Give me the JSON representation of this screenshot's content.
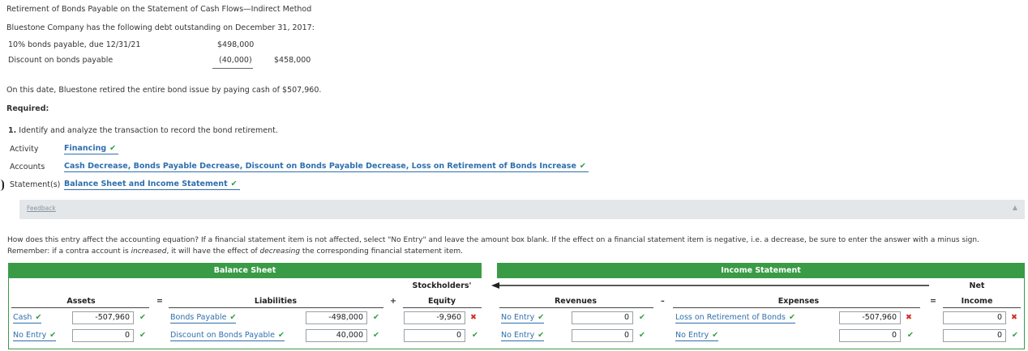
{
  "header": {
    "title": "Retirement of Bonds Payable on the Statement of Cash Flows—Indirect Method",
    "intro": "Bluestone Company has the following debt outstanding on December 31, 2017:",
    "debt": [
      {
        "label": "10% bonds payable, due 12/31/21",
        "amount": "$498,000",
        "net": ""
      },
      {
        "label": "Discount on bonds payable",
        "amount": "(40,000)",
        "net": "$458,000"
      }
    ],
    "retire_text": "On this date, Bluestone retired the entire bond issue by paying cash of $507,960.",
    "required": "Required:",
    "step1_num": "1.",
    "step1_text": "Identify and analyze the transaction to record the bond retirement."
  },
  "analysis": {
    "activity_label": "Activity",
    "activity_value": "Financing",
    "accounts_label": "Accounts",
    "accounts_value": "Cash Decrease, Bonds Payable Decrease, Discount on Bonds Payable Decrease, Loss on Retirement of Bonds Increase",
    "statements_label": "Statement(s)",
    "statements_value": "Balance Sheet and Income Statement"
  },
  "feedback": {
    "label": "Feedback"
  },
  "instructions": {
    "line1": "How does this entry affect the accounting equation? If a financial statement item is not affected, select \"No Entry\" and leave the amount box blank. If the effect on a financial statement item is negative, i.e. a decrease, be sure to enter the answer with a minus sign.",
    "line2_a": "Remember: if a contra account is ",
    "line2_b": "increased",
    "line2_c": ", it will have the effect of ",
    "line2_d": "decreasing",
    "line2_e": " the corresponding financial statement item."
  },
  "table": {
    "balance_sheet_header": "Balance Sheet",
    "income_statement_header": "Income Statement",
    "cols": {
      "assets": "Assets",
      "liabilities": "Liabilities",
      "equity_1": "Stockholders'",
      "equity_2": "Equity",
      "revenues": "Revenues",
      "expenses": "Expenses",
      "net_1": "Net",
      "net_2": "Income"
    },
    "ops": {
      "eq1": "=",
      "plus": "+",
      "minus": "–",
      "eq2": "="
    },
    "rows": [
      {
        "asset_acct": "Cash",
        "asset_amt": "-507,960",
        "liab_acct": "Bonds Payable",
        "liab_amt": "-498,000",
        "equity_amt": "-9,960",
        "rev_acct": "No Entry",
        "rev_amt": "0",
        "exp_acct": "Loss on Retirement of Bonds",
        "exp_amt": "-507,960",
        "net_amt": "0"
      },
      {
        "asset_acct": "No Entry",
        "asset_amt": "0",
        "liab_acct": "Discount on Bonds Payable",
        "liab_amt": "40,000",
        "equity_amt": "0",
        "rev_acct": "No Entry",
        "rev_amt": "0",
        "exp_acct": "No Entry",
        "exp_amt": "0",
        "net_amt": "0"
      }
    ]
  },
  "icons": {
    "check": "✔",
    "x": "✖",
    "arrow_up": "▲"
  },
  "colors": {
    "accent_green": "#3a9b46",
    "link_blue": "#2f6fad",
    "error_red": "#d62f2f"
  }
}
